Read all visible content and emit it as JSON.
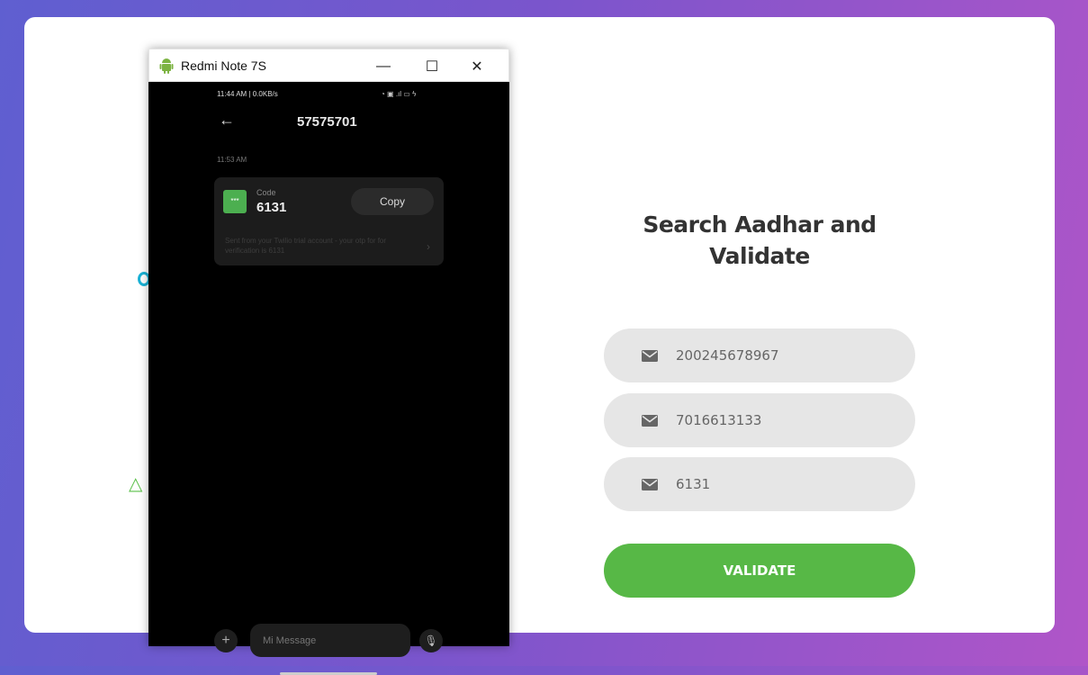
{
  "form": {
    "title": "Search Aadhar and Validate",
    "aadhar_value": "200245678967",
    "phone_value": "7016613133",
    "otp_value": "6131",
    "validate_label": "VALIDATE"
  },
  "emulator": {
    "window_title": "Redmi Note 7S",
    "minimize": "—",
    "maximize": "☐",
    "close": "✕",
    "status_time": "11:44 AM | 0.0KB/s",
    "status_icons": "◔ ▣ .ıl ▭ ϟ",
    "back_icon": "←",
    "contact": "57575701",
    "message_time": "11:53 AM",
    "code_label": "Code",
    "code_value": "6131",
    "copy_label": "Copy",
    "message_text": "Sent from your Twilio trial account - your otp for for verification is 6131",
    "input_placeholder": "Mi Message"
  },
  "colors": {
    "accent": "#57b846",
    "field_bg": "#e6e6e6"
  }
}
